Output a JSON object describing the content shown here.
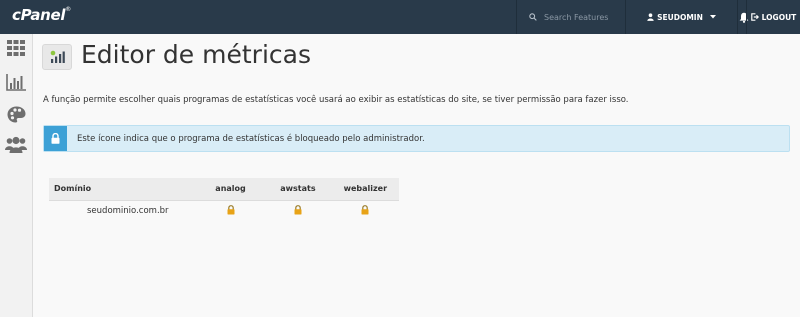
{
  "header": {
    "logo_text": "cPanel",
    "logo_mark": "®",
    "search_placeholder": "Search Features",
    "username": "SEUDOMIN",
    "logout_label": "LOGOUT"
  },
  "sidebar": {
    "items": [
      {
        "icon": "grid-icon"
      },
      {
        "icon": "bar-chart-icon"
      },
      {
        "icon": "palette-icon"
      },
      {
        "icon": "users-icon"
      }
    ]
  },
  "page": {
    "title": "Editor de métricas",
    "description": "A função permite escolher quais programas de estatísticas você usará ao exibir as estatísticas do site, se tiver permissão para fazer isso.",
    "alert": "Este ícone indica que o programa de estatísticas é bloqueado pelo administrador."
  },
  "table": {
    "columns": [
      "Domínio",
      "analog",
      "awstats",
      "webalizer"
    ],
    "rows": [
      {
        "domain": "seudominio.com.br",
        "analog": "locked",
        "awstats": "locked",
        "webalizer": "locked"
      }
    ]
  },
  "colors": {
    "topbar": "#293a4a",
    "alert_bg": "#d9edf7",
    "alert_icon": "#3da1d6",
    "lock": "#e8a317"
  }
}
